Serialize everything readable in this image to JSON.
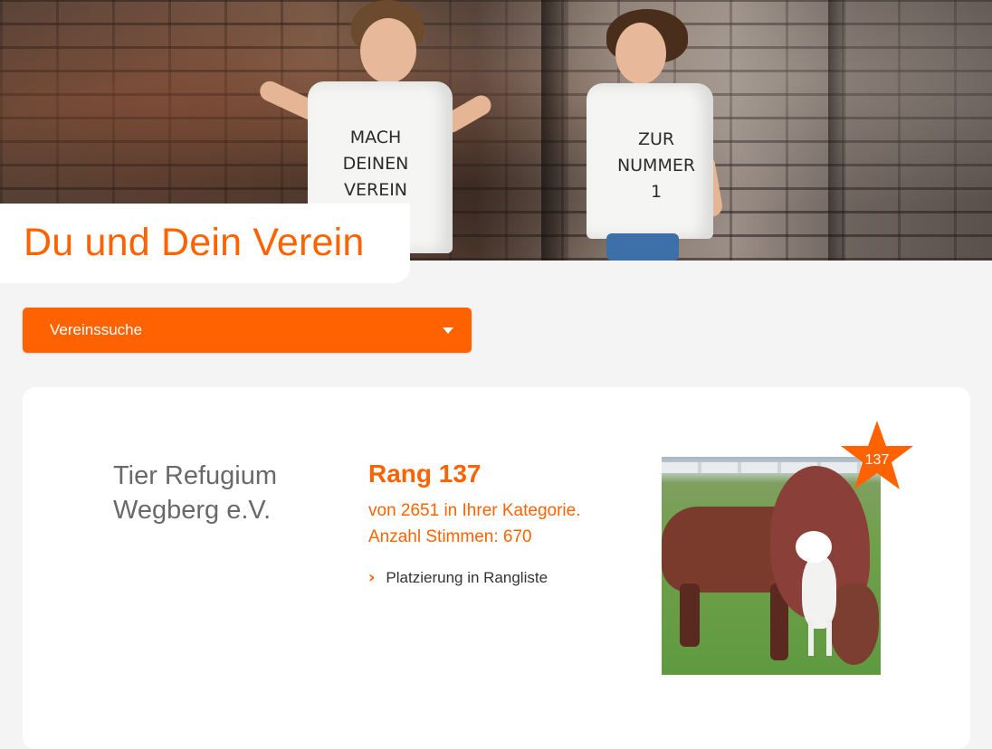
{
  "hero": {
    "title": "Du und Dein Verein",
    "shirt_left": [
      "MACH",
      "DEINEN",
      "VEREIN"
    ],
    "shirt_right": [
      "ZUR",
      "NUMMER",
      "1"
    ]
  },
  "search": {
    "label": "Vereinssuche"
  },
  "club": {
    "name_line1": "Tier Refugium",
    "name_line2": "Wegberg e.V.",
    "rank_label": "Rang 137",
    "rank_sub1": "von 2651 in Ihrer Kategorie.",
    "rank_sub2": "Anzahl Stimmen: 670",
    "link_label": "Platzierung in Rangliste",
    "badge_number": "137"
  },
  "colors": {
    "accent": "#ff6200",
    "background": "#f4f4f4",
    "card": "#ffffff",
    "text_gray": "#696969"
  },
  "icons": {
    "dropdown_caret": "caret-down-icon",
    "link_chevron": "chevron-right-icon",
    "rank_star": "star-badge-icon"
  }
}
